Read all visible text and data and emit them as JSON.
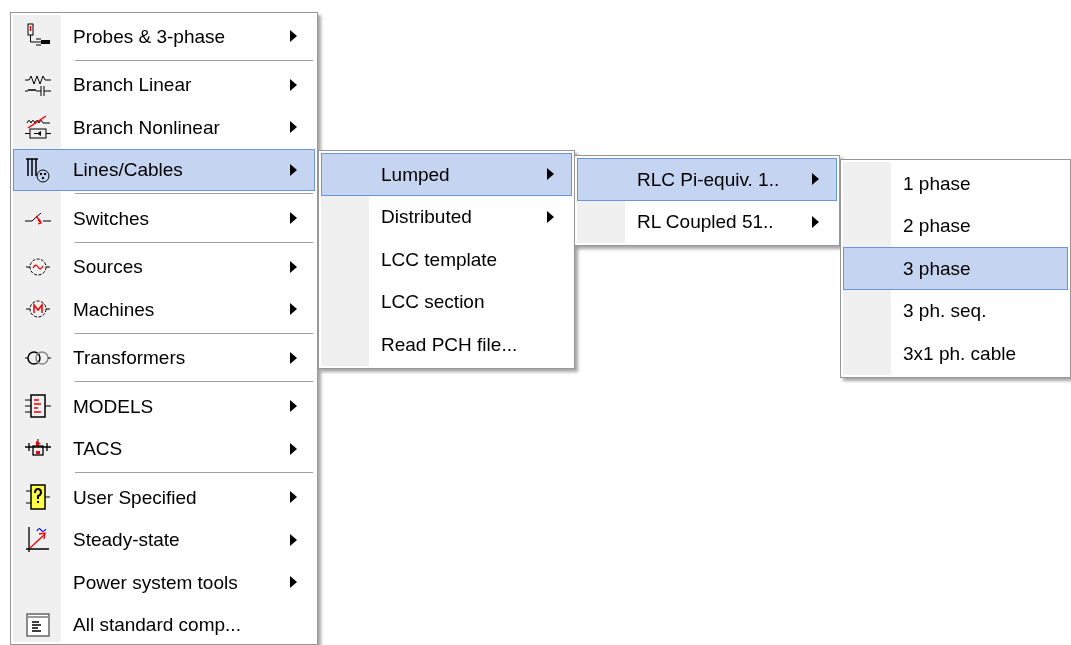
{
  "menus": [
    {
      "items": [
        {
          "kind": "item",
          "label": "Probes & 3-phase",
          "submenu": true,
          "selected": false
        },
        {
          "kind": "separator"
        },
        {
          "kind": "item",
          "label": "Branch Linear",
          "submenu": true,
          "selected": false
        },
        {
          "kind": "item",
          "label": "Branch Nonlinear",
          "submenu": true,
          "selected": false
        },
        {
          "kind": "item",
          "label": "Lines/Cables",
          "submenu": true,
          "selected": true
        },
        {
          "kind": "separator"
        },
        {
          "kind": "item",
          "label": "Switches",
          "submenu": true,
          "selected": false
        },
        {
          "kind": "separator"
        },
        {
          "kind": "item",
          "label": "Sources",
          "submenu": true,
          "selected": false
        },
        {
          "kind": "item",
          "label": "Machines",
          "submenu": true,
          "selected": false
        },
        {
          "kind": "separator"
        },
        {
          "kind": "item",
          "label": "Transformers",
          "submenu": true,
          "selected": false
        },
        {
          "kind": "separator"
        },
        {
          "kind": "item",
          "label": "MODELS",
          "submenu": true,
          "selected": false
        },
        {
          "kind": "item",
          "label": "TACS",
          "submenu": true,
          "selected": false
        },
        {
          "kind": "separator"
        },
        {
          "kind": "item",
          "label": "User Specified",
          "submenu": true,
          "selected": false
        },
        {
          "kind": "item",
          "label": "Steady-state",
          "submenu": true,
          "selected": false
        },
        {
          "kind": "item",
          "label": "Power system tools",
          "submenu": true,
          "selected": false
        },
        {
          "kind": "item",
          "label": "All standard comp...",
          "submenu": false,
          "selected": false
        }
      ]
    },
    {
      "items": [
        {
          "kind": "item",
          "label": "Lumped",
          "submenu": true,
          "selected": true
        },
        {
          "kind": "item",
          "label": "Distributed",
          "submenu": true,
          "selected": false
        },
        {
          "kind": "item",
          "label": "LCC template",
          "submenu": false,
          "selected": false
        },
        {
          "kind": "item",
          "label": "LCC section",
          "submenu": false,
          "selected": false
        },
        {
          "kind": "item",
          "label": "Read PCH file...",
          "submenu": false,
          "selected": false
        }
      ]
    },
    {
      "items": [
        {
          "kind": "item",
          "label": "RLC Pi-equiv. 1..",
          "submenu": true,
          "selected": true
        },
        {
          "kind": "item",
          "label": "RL Coupled 51..",
          "submenu": true,
          "selected": false
        }
      ]
    },
    {
      "items": [
        {
          "kind": "item",
          "label": "1 phase",
          "submenu": false,
          "selected": false
        },
        {
          "kind": "item",
          "label": "2 phase",
          "submenu": false,
          "selected": false
        },
        {
          "kind": "item",
          "label": "3 phase",
          "submenu": false,
          "selected": true
        },
        {
          "kind": "item",
          "label": "3 ph. seq.",
          "submenu": false,
          "selected": false
        },
        {
          "kind": "item",
          "label": "3x1 ph. cable",
          "submenu": false,
          "selected": false
        }
      ]
    }
  ]
}
